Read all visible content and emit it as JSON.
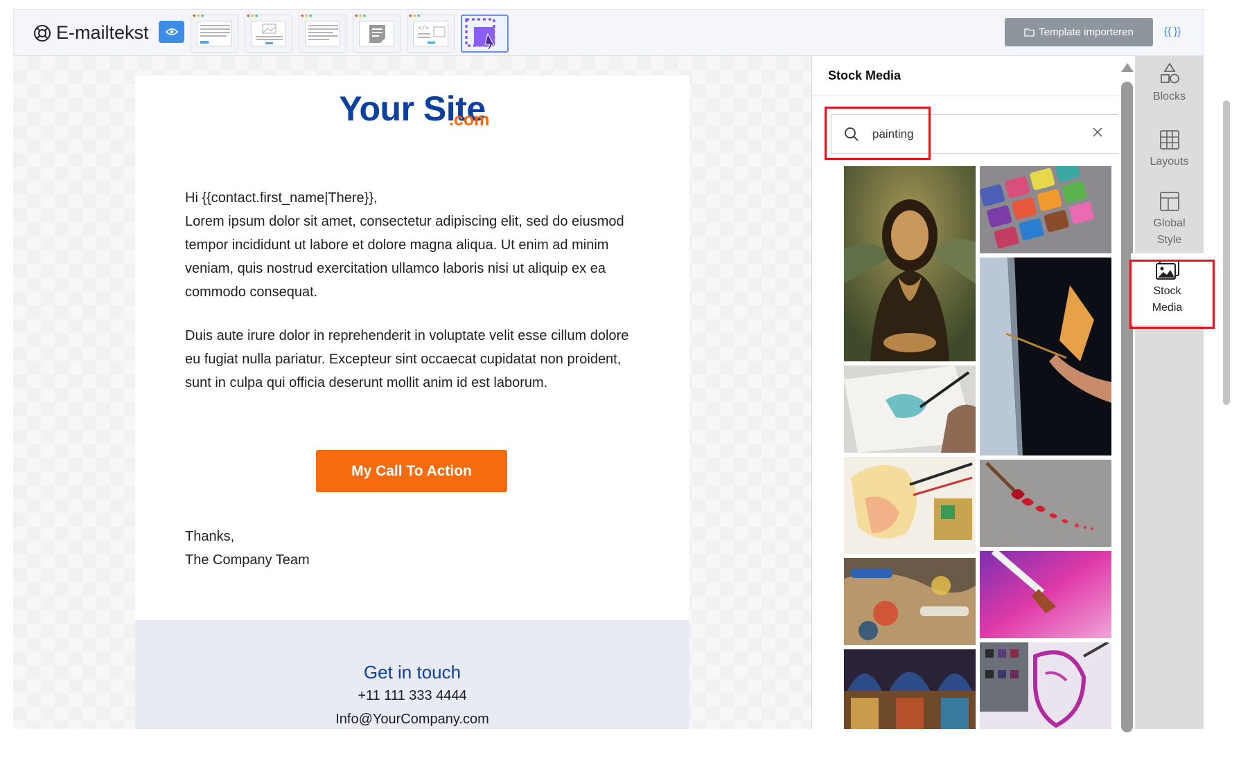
{
  "header": {
    "title": "E-mailtekst",
    "import_label": "Template importeren",
    "code_label": "{{ }}",
    "templates": [
      "text-template",
      "image-text-template",
      "text-list-template",
      "note-template",
      "code-image-template",
      "drag-drop-template"
    ]
  },
  "email": {
    "logo_main": "Your Site",
    "logo_suffix": ".com",
    "greeting": "Hi {{contact.first_name|There}},",
    "paragraph1": "Lorem ipsum dolor sit amet, consectetur adipiscing elit, sed do eiusmod tempor incididunt ut labore et dolore magna aliqua. Ut enim ad minim veniam, quis nostrud exercitation ullamco laboris nisi ut aliquip ex ea commodo consequat.",
    "paragraph2": "Duis aute irure dolor in reprehenderit in voluptate velit esse cillum dolore eu fugiat nulla pariatur. Excepteur sint occaecat cupidatat non proident, sunt in culpa qui officia deserunt mollit anim id est laborum.",
    "cta_label": "My Call To Action",
    "thanks": "Thanks,",
    "team": "The Company Team",
    "footer_title": "Get in touch",
    "footer_phone": "+11 111 333 4444",
    "footer_email": "Info@YourCompany.com"
  },
  "media_panel": {
    "title": "Stock Media",
    "search_value": "painting",
    "images": [
      "mona-lisa-painting",
      "watercolor-paint-palette",
      "artist-painting-canvas-dark",
      "hand-painting-watercolor",
      "watercolor-portrait-brushes",
      "red-hearts-paintbrush",
      "oil-paint-tubes-palette",
      "pink-paint-brush-stroke",
      "church-fresco-painting",
      "purple-watercolor-portrait"
    ]
  },
  "toolbar": {
    "items": [
      {
        "label": "Blocks",
        "icon": "shapes-icon"
      },
      {
        "label": "Layouts",
        "icon": "grid-icon"
      },
      {
        "label": "Global Style",
        "line1": "Global",
        "line2": "Style",
        "icon": "layout-icon"
      },
      {
        "label": "Stock Media",
        "line1": "Stock",
        "line2": "Media",
        "icon": "image-icon"
      }
    ]
  },
  "colors": {
    "accent_blue": "#3d8de6",
    "logo_blue": "#0b3fa0",
    "cta_orange": "#f66b0e",
    "highlight_red": "#e0141e"
  }
}
